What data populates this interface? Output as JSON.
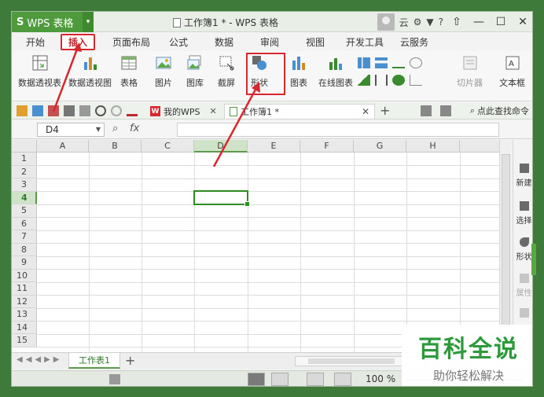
{
  "app": {
    "name": "WPS 表格",
    "doc_title": "工作簿1 * - WPS 表格",
    "user_label": "云",
    "help_label": "?"
  },
  "menu_tabs": [
    {
      "label": "开始",
      "active": false
    },
    {
      "label": "插入",
      "active": true
    },
    {
      "label": "页面布局",
      "active": false
    },
    {
      "label": "公式",
      "active": false
    },
    {
      "label": "数据",
      "active": false
    },
    {
      "label": "审阅",
      "active": false
    },
    {
      "label": "视图",
      "active": false
    },
    {
      "label": "开发工具",
      "active": false
    },
    {
      "label": "云服务",
      "active": false
    }
  ],
  "ribbon": {
    "pivot_table": "数据透视表",
    "pivot_chart": "数据透视图",
    "table": "表格",
    "picture": "图片",
    "gallery": "图库",
    "screenshot": "截屏",
    "shape": "形状",
    "chart": "图表",
    "online_chart": "在线图表",
    "slicer": "切片器",
    "textbox": "文本框"
  },
  "doc_tabs": {
    "wps_home": "我的WPS",
    "current": "工作簿1 *",
    "search_cmd": "点此查找命令"
  },
  "formula_bar": {
    "name_box": "D4",
    "fx_label": "fx",
    "formula": ""
  },
  "grid": {
    "columns": [
      "A",
      "B",
      "C",
      "D",
      "E",
      "F",
      "G",
      "H"
    ],
    "rows": [
      "1",
      "2",
      "3",
      "4",
      "5",
      "6",
      "7",
      "8",
      "9",
      "10",
      "11",
      "12",
      "13",
      "14",
      "15"
    ],
    "selected_col": "D",
    "selected_row": "4"
  },
  "side_pane": [
    {
      "label": "新建",
      "enabled": true
    },
    {
      "label": "选择",
      "enabled": true
    },
    {
      "label": "形状",
      "enabled": true
    },
    {
      "label": "属性",
      "enabled": false
    }
  ],
  "sheets": [
    {
      "label": "工作表1",
      "active": true
    }
  ],
  "status": {
    "zoom": "100 %"
  },
  "watermark": {
    "title": "百科全说",
    "subtitle": "助你轻松解决"
  },
  "colors": {
    "accent_green": "#4f9a3c",
    "highlight_red": "#d6282e"
  }
}
